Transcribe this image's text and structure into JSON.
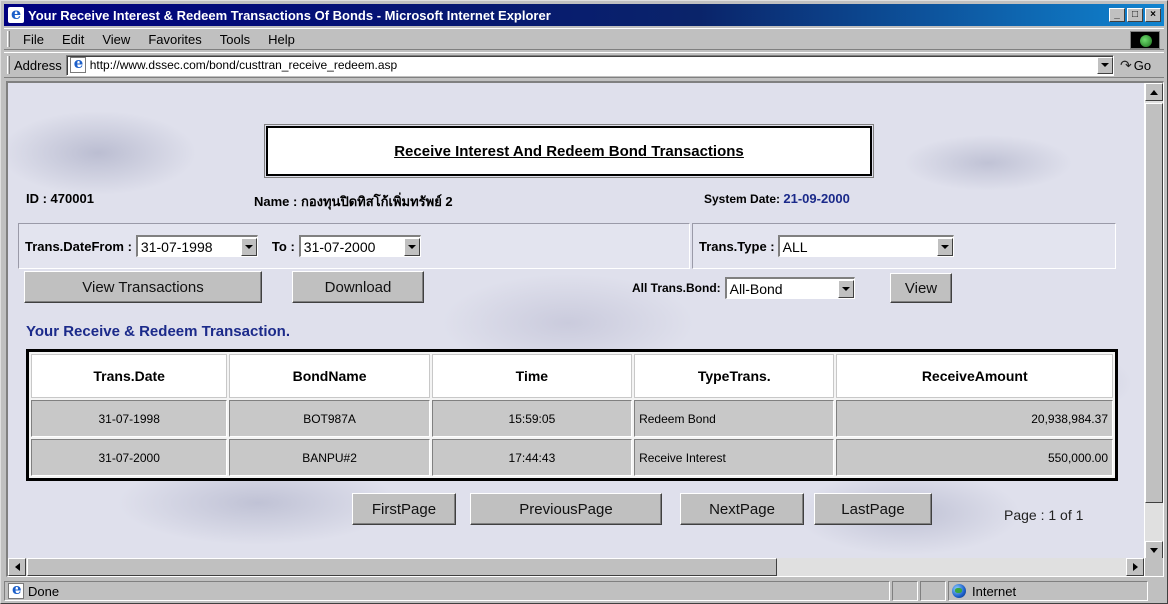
{
  "window": {
    "title": "Your Receive Interest & Redeem Transactions Of Bonds - Microsoft Internet Explorer",
    "controls": [
      "_",
      "□",
      "×"
    ]
  },
  "menu": {
    "items": [
      {
        "label": "File"
      },
      {
        "label": "Edit"
      },
      {
        "label": "View"
      },
      {
        "label": "Favorites"
      },
      {
        "label": "Tools"
      },
      {
        "label": "Help"
      }
    ]
  },
  "address": {
    "label": "Address",
    "url": "http://www.dssec.com/bond/custtran_receive_redeem.asp",
    "go_label": "Go"
  },
  "page": {
    "title": "Receive Interest And Redeem Bond Transactions",
    "id_text": "ID : 470001",
    "name_text": "Name : กองทุนปิดทิสโก้เพิ่มทรัพย์ 2",
    "system_date_label": "System Date:",
    "system_date_value": "21-09-2000",
    "date_from_label": "Trans.DateFrom :",
    "date_from_value": "31-07-1998",
    "to_label": "To :",
    "to_value": "31-07-2000",
    "trans_type_label": "Trans.Type :",
    "trans_type_value": "ALL",
    "view_transactions_label": "View Transactions",
    "download_label": "Download",
    "all_trans_bond_label": "All Trans.Bond:",
    "all_trans_bond_value": "All-Bond",
    "view_label": "View",
    "section_label": "Your Receive & Redeem Transaction.",
    "table": {
      "headers": [
        "Trans.Date",
        "BondName",
        "Time",
        "TypeTrans.",
        "ReceiveAmount"
      ],
      "rows": [
        [
          "31-07-1998",
          "BOT987A",
          "15:59:05",
          "Redeem Bond",
          "20,938,984.37"
        ],
        [
          "31-07-2000",
          "BANPU#2",
          "17:44:43",
          "Receive Interest",
          "550,000.00"
        ]
      ]
    },
    "pager": {
      "first": "FirstPage",
      "previous": "PreviousPage",
      "next": "NextPage",
      "last": "LastPage",
      "page_info": "Page : 1 of 1"
    }
  },
  "status": {
    "text": "Done",
    "zone": "Internet"
  },
  "colors": {
    "title_bar": "#000080",
    "section_label": "#1b2a8a",
    "system_date_value": "#1b2a8a"
  },
  "icons": [
    "ie-logo-icon",
    "windows-logo-throbber-icon",
    "page-icon",
    "go-arrow-icon",
    "globe-icon"
  ]
}
